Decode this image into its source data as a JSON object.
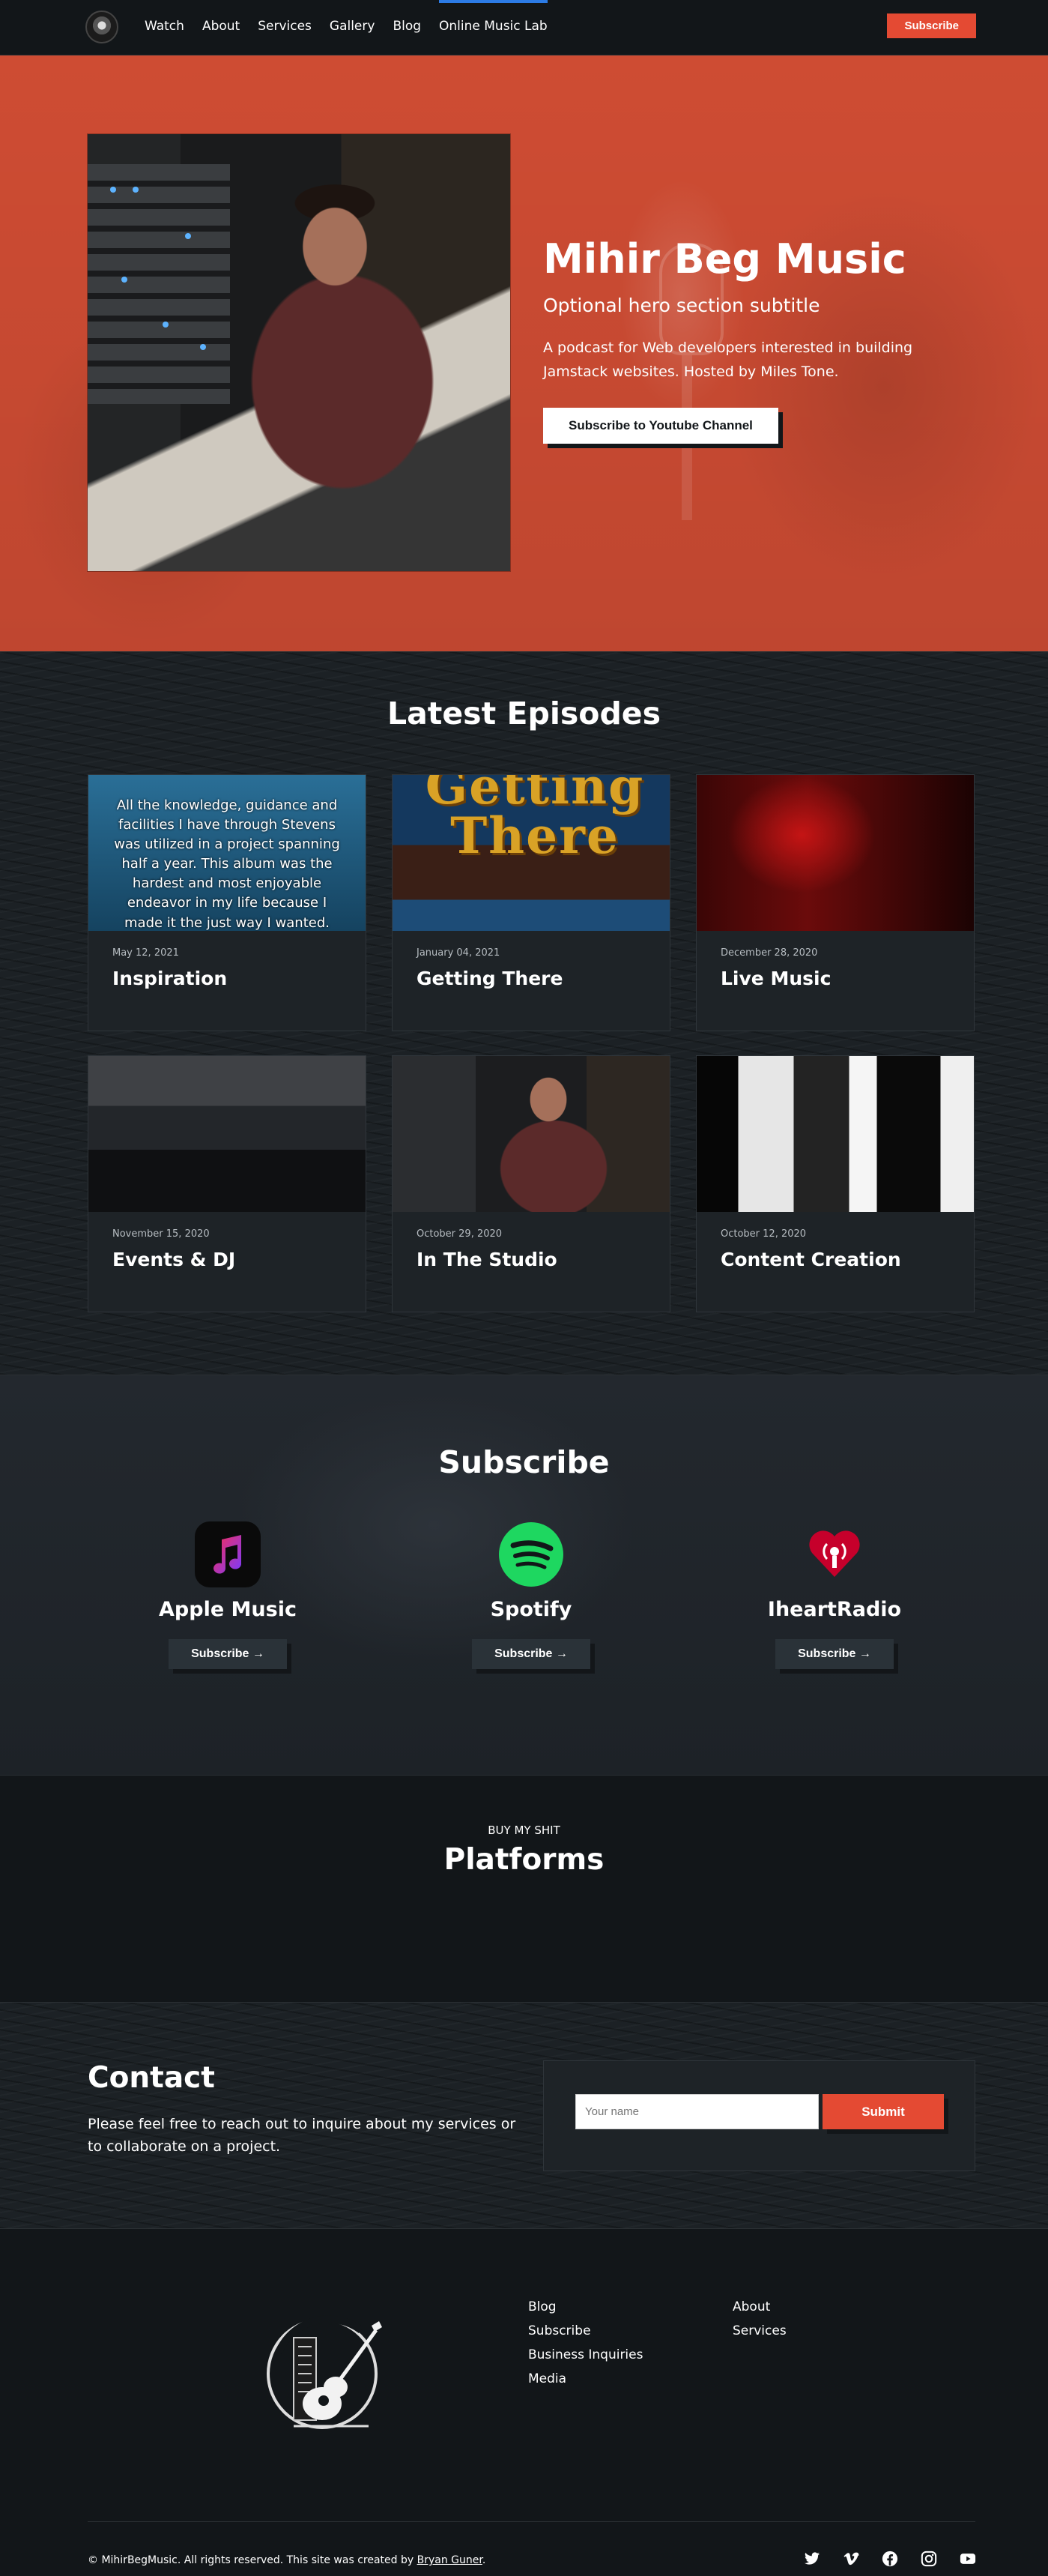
{
  "nav": {
    "links": [
      "Watch",
      "About",
      "Services",
      "Gallery",
      "Blog",
      "Online Music Lab"
    ],
    "active": "Online Music Lab",
    "subscribe_label": "Subscribe"
  },
  "hero": {
    "title": "Mihir Beg Music",
    "subtitle": "Optional hero section subtitle",
    "description": "A podcast for Web developers interested in building Jamstack websites. Hosted by Miles Tone.",
    "button_label": "Subscribe to Youtube Channel"
  },
  "episodes": {
    "title": "Latest Episodes",
    "inspiration_image_text": "All the knowledge, guidance and facilities I have through Stevens was utilized in a project spanning half a year. This album was the hardest and most enjoyable endeavor in my life because I made it the just way I wanted.",
    "getting_there_image_text": "Getting There",
    "items": [
      {
        "date": "May 12, 2021",
        "title": "Inspiration"
      },
      {
        "date": "January 04, 2021",
        "title": "Getting There"
      },
      {
        "date": "December 28, 2020",
        "title": "Live Music"
      },
      {
        "date": "November 15, 2020",
        "title": "Events & DJ"
      },
      {
        "date": "October 29, 2020",
        "title": "In The Studio"
      },
      {
        "date": "October 12, 2020",
        "title": "Content Creation"
      }
    ]
  },
  "subscribe": {
    "title": "Subscribe",
    "platforms": [
      {
        "name": "Apple Music",
        "button": "Subscribe →",
        "icon": "apple-music-icon",
        "color": "#fa2d55"
      },
      {
        "name": "Spotify",
        "button": "Subscribe →",
        "icon": "spotify-icon",
        "color": "#1ed760"
      },
      {
        "name": "IheartRadio",
        "button": "Subscribe →",
        "icon": "iheartradio-icon",
        "color": "#c6002b"
      }
    ]
  },
  "platforms": {
    "kicker": "BUY MY SHIT",
    "title": "Platforms"
  },
  "contact": {
    "title": "Contact",
    "description": "Please feel free to reach out to inquire about my services or to collaborate on a project.",
    "name_placeholder": "Your name",
    "submit_label": "Submit"
  },
  "footer": {
    "col1": [
      "Blog",
      "Subscribe",
      "Business Inquiries",
      "Media"
    ],
    "col2": [
      "About",
      "Services"
    ],
    "copyright_prefix": "© MihirBegMusic. All rights reserved. This site was created by ",
    "creator": "Bryan Guner",
    "copyright_suffix": ".",
    "socials": [
      "twitter-icon",
      "vimeo-icon",
      "facebook-icon",
      "instagram-icon",
      "youtube-icon"
    ]
  },
  "colors": {
    "accent": "#e44a33",
    "hero_bg": "#d95036",
    "dark_bg": "#121619"
  }
}
